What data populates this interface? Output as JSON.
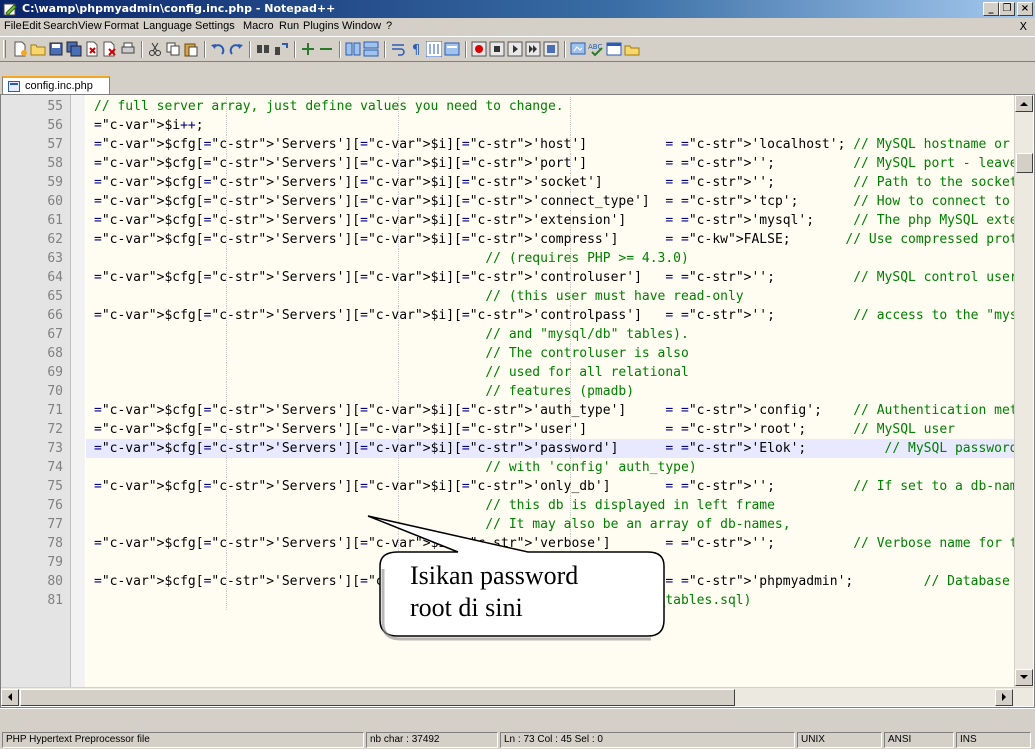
{
  "window": {
    "title": "C:\\wamp\\phpmyadmin\\config.inc.php - Notepad++",
    "minimize": "_",
    "maximize": "❐",
    "close": "×"
  },
  "menu": {
    "items": [
      "File",
      "Edit",
      "Search",
      "View",
      "Format",
      "Language",
      "Settings",
      "Macro",
      "Run",
      "Plugins",
      "Window",
      "?"
    ],
    "close_doc": "X"
  },
  "tabs": [
    {
      "label": "config.inc.php",
      "active": true
    }
  ],
  "editor": {
    "current_line": 73,
    "lines": [
      {
        "n": "55",
        "code": "// full server array, just define values you need to change."
      },
      {
        "n": "56",
        "code": "$i++;"
      },
      {
        "n": "57",
        "code": "$cfg['Servers'][$i]['host']          = 'localhost'; // MySQL hostname or IP address"
      },
      {
        "n": "58",
        "code": "$cfg['Servers'][$i]['port']          = '';          // MySQL port - leave blank for default"
      },
      {
        "n": "59",
        "code": "$cfg['Servers'][$i]['socket']        = '';          // Path to the socket - leave blank for"
      },
      {
        "n": "60",
        "code": "$cfg['Servers'][$i]['connect_type']  = 'tcp';       // How to connect to MySQL server ('tcp"
      },
      {
        "n": "61",
        "code": "$cfg['Servers'][$i]['extension']     = 'mysql';     // The php MySQL extension to use ('mys"
      },
      {
        "n": "62",
        "code": "$cfg['Servers'][$i]['compress']      = FALSE;       // Use compressed protocol for the MySQ"
      },
      {
        "n": "63",
        "code": "                                                  // (requires PHP >= 4.3.0)"
      },
      {
        "n": "64",
        "code": "$cfg['Servers'][$i]['controluser']   = '';          // MySQL control user settings"
      },
      {
        "n": "65",
        "code": "                                                  // (this user must have read-only"
      },
      {
        "n": "66",
        "code": "$cfg['Servers'][$i]['controlpass']   = '';          // access to the \"mysql/user\""
      },
      {
        "n": "67",
        "code": "                                                  // and \"mysql/db\" tables)."
      },
      {
        "n": "68",
        "code": "                                                  // The controluser is also"
      },
      {
        "n": "69",
        "code": "                                                  // used for all relational"
      },
      {
        "n": "70",
        "code": "                                                  // features (pmadb)"
      },
      {
        "n": "71",
        "code": "$cfg['Servers'][$i]['auth_type']     = 'config';    // Authentication method (config, http"
      },
      {
        "n": "72",
        "code": "$cfg['Servers'][$i]['user']          = 'root';      // MySQL user"
      },
      {
        "n": "73",
        "code": "$cfg['Servers'][$i]['password']      = 'Elok';          // MySQL password (only needed"
      },
      {
        "n": "74",
        "code": "                                                  // with 'config' auth_type)"
      },
      {
        "n": "75",
        "code": "$cfg['Servers'][$i]['only_db']       = '';          // If set to a db-name, only"
      },
      {
        "n": "76",
        "code": "                                                  // this db is displayed in left frame"
      },
      {
        "n": "77",
        "code": "                                                  // It may also be an array of db-names,"
      },
      {
        "n": "78",
        "code": "$cfg['Servers'][$i]['verbose']       = '';          // Verbose name for this host - leave b"
      },
      {
        "n": "79",
        "code": ""
      },
      {
        "n": "80",
        "code": "$cfg['Servers'][$i]['pmadb']         = 'phpmyadmin';         // Database used for Relation"
      },
      {
        "n": "81",
        "code": "                                                  // (see scripts/create_tables.sql)"
      }
    ]
  },
  "callout": {
    "line1": "Isikan password",
    "line2": "root di sini"
  },
  "status": {
    "filetype": "PHP Hypertext Preprocessor file",
    "nbchar": "nb char : 37492",
    "position": "Ln : 73   Col : 45   Sel : 0",
    "eol": "UNIX",
    "encoding": "ANSI",
    "mode": "INS"
  }
}
